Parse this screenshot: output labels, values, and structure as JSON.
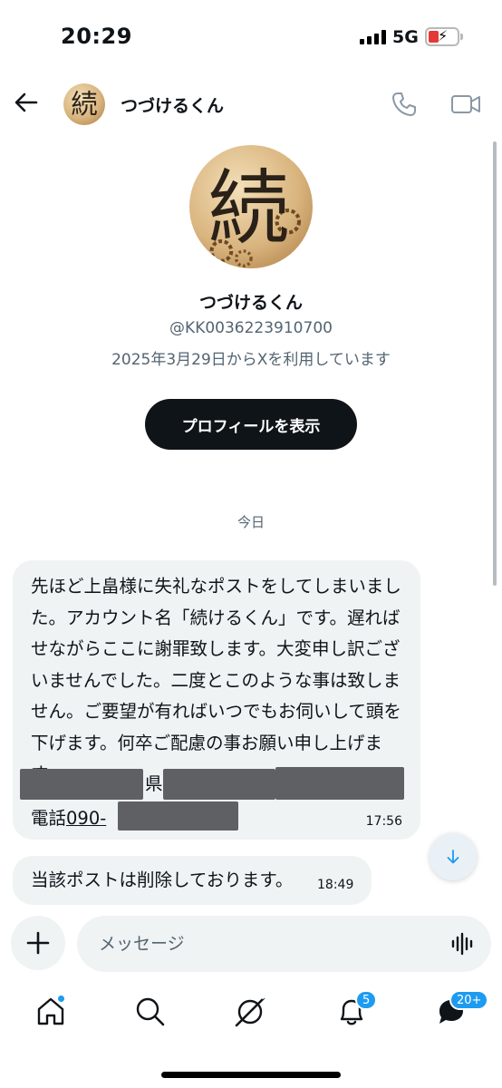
{
  "status_bar": {
    "time": "20:29",
    "network": "5G"
  },
  "header": {
    "name": "つづけるくん"
  },
  "profile": {
    "name": "つづけるくん",
    "handle": "@KK0036223910700",
    "joined": "2025年3月29日からXを利用しています",
    "button_label": "プロフィールを表示",
    "avatar_char": "続"
  },
  "conversation": {
    "date_divider": "今日",
    "messages": [
      {
        "text": "先ほど上畠様に失礼なポストをしてしまいました。アカウント名「続けるくん」です。遅ればせながらここに謝罪致します。大変申し訳ございませんでした。二度とこのような事は致しません。ご要望が有ればいつでもお伺いして頭を下げます。何卒ご配慮の事お願い申し上げます。",
        "prefecture_suffix": "県",
        "tel_label": "電話",
        "tel_prefix": "090-",
        "time": "17:56"
      },
      {
        "text": "当該ポストは削除しております。",
        "time": "18:49"
      }
    ]
  },
  "composer": {
    "placeholder": "メッセージ"
  },
  "nav": {
    "notifications_badge": "5",
    "messages_badge": "20+",
    "accent": "#1d9bf0"
  }
}
